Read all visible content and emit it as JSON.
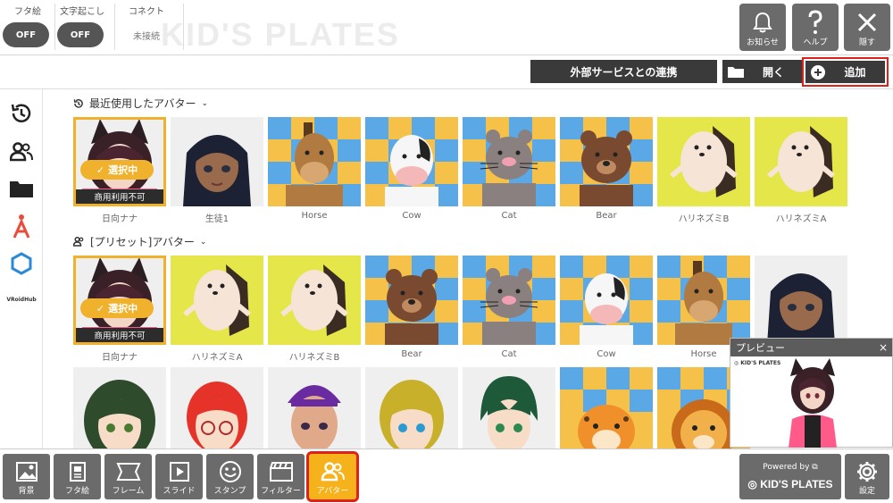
{
  "topbar": {
    "toggles": [
      {
        "label": "フタ絵",
        "state": "OFF"
      },
      {
        "label": "文字起こし",
        "state": "OFF"
      }
    ],
    "connect": {
      "label": "コネクト",
      "status": "未接続"
    },
    "watermark": "KID'S PLATES",
    "buttons": [
      {
        "label": "お知らせ",
        "icon": "bell-icon"
      },
      {
        "label": "ヘルプ",
        "icon": "question-icon"
      },
      {
        "label": "隠す",
        "icon": "close-icon"
      }
    ]
  },
  "actionbar": {
    "external_label": "外部サービスとの連携",
    "open_label": "開く",
    "add_label": "追加"
  },
  "sidebar": {
    "items": [
      {
        "icon": "history-icon"
      },
      {
        "icon": "users-icon"
      },
      {
        "icon": "folder-icon"
      },
      {
        "icon": "avatar-a-icon"
      },
      {
        "icon": "hexagon-icon"
      }
    ],
    "vroid_label": "VRoidHub"
  },
  "recent": {
    "title": "最近使用したアバター",
    "items": [
      {
        "name": "日向ナナ",
        "selected": true,
        "commercial": "商用利用不可",
        "selected_label": "選択中"
      },
      {
        "name": "生徒1"
      },
      {
        "name": "Horse"
      },
      {
        "name": "Cow"
      },
      {
        "name": "Cat"
      },
      {
        "name": "Bear"
      },
      {
        "name": "ハリネズミB"
      },
      {
        "name": "ハリネズミA"
      }
    ]
  },
  "preset": {
    "title": "[プリセット]アバター",
    "items": [
      {
        "name": "日向ナナ",
        "selected": true,
        "commercial": "商用利用不可",
        "selected_label": "選択中"
      },
      {
        "name": "ハリネズミA"
      },
      {
        "name": "ハリネズミB"
      },
      {
        "name": "Bear"
      },
      {
        "name": "Cat"
      },
      {
        "name": "Cow"
      },
      {
        "name": "Horse"
      },
      {
        "name": ""
      }
    ]
  },
  "preview": {
    "title": "プレビュー",
    "close": "×",
    "brand": "KID'S PLATES"
  },
  "bottombar": {
    "tools": [
      {
        "label": "背景",
        "icon": "background-icon"
      },
      {
        "label": "フタ絵",
        "icon": "lid-picture-icon"
      },
      {
        "label": "フレーム",
        "icon": "frame-icon"
      },
      {
        "label": "スライド",
        "icon": "slide-icon"
      },
      {
        "label": "スタンプ",
        "icon": "stamp-icon"
      },
      {
        "label": "フィルター",
        "icon": "filter-icon"
      },
      {
        "label": "アバター",
        "icon": "avatar-icon",
        "active": true
      }
    ],
    "powered_by": "Powered by",
    "powered_brand": "KID'S PLATES",
    "settings_label": "設定"
  },
  "colors": {
    "accent_yellow": "#f5b21b",
    "select_frame": "#f0b22c",
    "highlight_red": "#e0201a",
    "button_gray": "#6b6b6b",
    "dark_button": "#3a3a3a"
  }
}
